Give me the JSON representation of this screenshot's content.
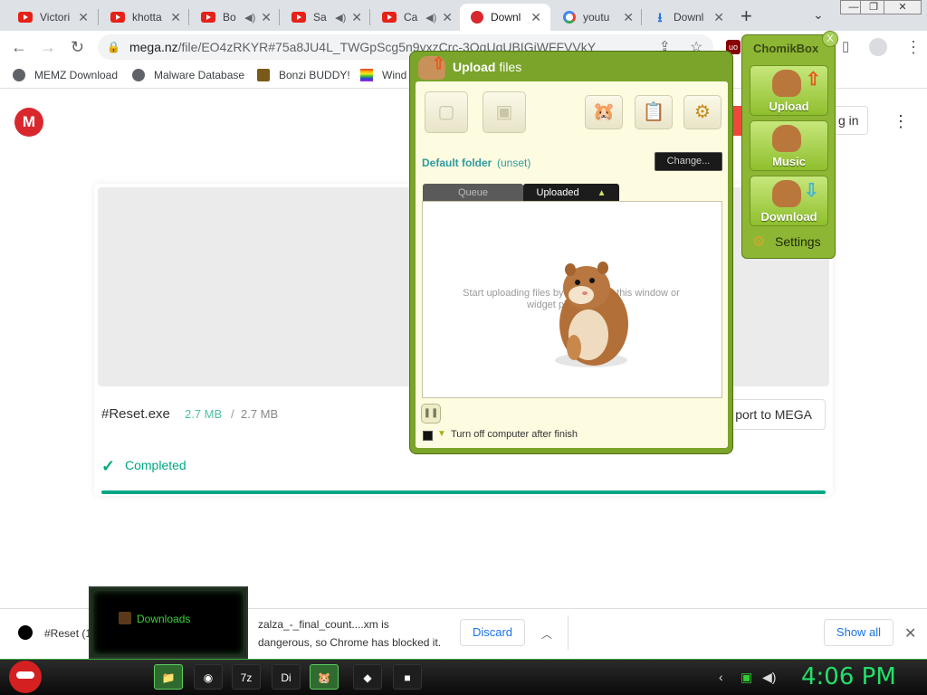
{
  "tabs": [
    {
      "title": "Victori",
      "icon": "youtube-icon",
      "audio": false
    },
    {
      "title": "khotta",
      "icon": "youtube-icon",
      "audio": false
    },
    {
      "title": "Bo",
      "icon": "youtube-icon",
      "audio": true
    },
    {
      "title": "Sa",
      "icon": "youtube-icon",
      "audio": true
    },
    {
      "title": "Ca",
      "icon": "youtube-icon",
      "audio": true
    },
    {
      "title": "Downl",
      "icon": "mega-icon",
      "audio": false,
      "active": true
    },
    {
      "title": "youtu",
      "icon": "google-icon",
      "audio": false
    },
    {
      "title": "Downl",
      "icon": "download-icon",
      "audio": false
    }
  ],
  "toolbar": {
    "url_host": "mega.nz",
    "url_path": "/file/EO4zRKYR#75a8JU4L_TWGpScg5n9yxzCrc-3OqUqUBIGjWFFVVkY"
  },
  "bookmarks": [
    {
      "label": "MEMZ Download"
    },
    {
      "label": "Malware Database"
    },
    {
      "label": "Bonzi BUDDY!"
    },
    {
      "label": "Wind"
    }
  ],
  "page": {
    "logo": "M",
    "login_label": "g in",
    "filename": "#Reset.exe",
    "size_done": "2.7 MB",
    "size_sep": "/",
    "size_total": "2.7 MB",
    "import_label": "port to MEGA",
    "status": "Completed",
    "progress": 1.0
  },
  "upload": {
    "title_bold": "Upload",
    "title_rest": " files",
    "default_folder_label": "Default folder",
    "default_folder_value": "(unset)",
    "change_label": "Change...",
    "tab_queue": "Queue",
    "tab_uploaded": "Uploaded",
    "hint_line1": "Start uploading files by dragg      over this window or",
    "hint_line2": "widget placed o               top.",
    "shutdown_label": "Turn off computer after finish"
  },
  "widget": {
    "title": "ChomikBox",
    "close": "X",
    "upload": "Upload",
    "music": "Music",
    "download": "Download",
    "settings": "Settings"
  },
  "downloads_bar": {
    "item": "#Reset (1",
    "msg_line1": "zalza_-_final_count....xm is",
    "msg_line2": "dangerous, so Chrome has blocked it.",
    "discard": "Discard",
    "show_all": "Show all"
  },
  "downloads_popup": {
    "label": "Downloads"
  },
  "taskbar": {
    "clock": "4:06 PM"
  },
  "colors": {
    "mega_red": "#d9272e",
    "success_green": "#00a884",
    "chomik_green": "#7aa42a",
    "clock_green": "#22e06a"
  }
}
